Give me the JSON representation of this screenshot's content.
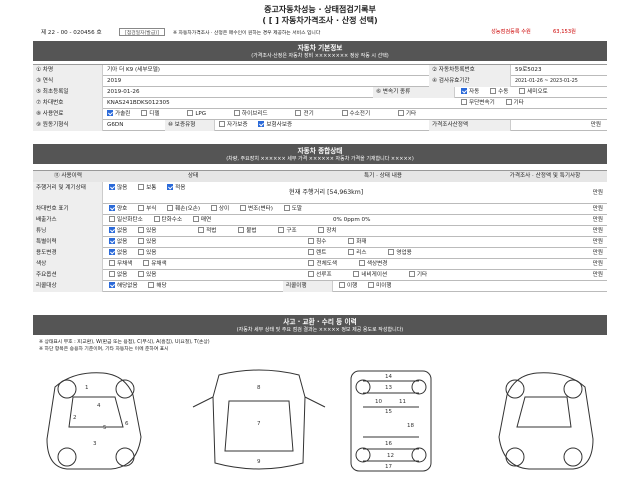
{
  "header": {
    "title": "중고자동차성능 · 상태점검기록부",
    "subtitle": "( [ ] 자동차가격조사 · 산정 선택)",
    "doc_no": "제 22 - 00 - 020456 호",
    "doc_no_box": "[점검일자(발급)]",
    "notice": "※ 자동차가격조사 · 산정은 매수인이 원하는 경우 제공하는 서비스 입니다",
    "right_red": "성능점검등록 수원",
    "fee": "63,153원"
  },
  "sections": {
    "basic": {
      "title": "자동차 기본정보",
      "sub": "(가격조사·산정은 자동차 장비 ×××××××× 정상 작동 시 선택)"
    },
    "state": {
      "title": "자동차 종합상태",
      "sub": "(차량, 주요장치 ×××××× 세부 가격 ×××××× 자동차 가격을 기재합니다 ×××××)"
    },
    "repair": {
      "title": "사고 · 교환 · 수리 등 이력",
      "sub": "(자동차 세부 상태 및 주요 점검 결과는 ××××× 정보 제공 용도로 작성합니다)"
    }
  },
  "basic_rows": [
    {
      "n": "① 차명",
      "v": "기아 더 K9 (세부모델)",
      "n2": "② 자동차등록번호",
      "v2": "59로5023"
    },
    {
      "n": "③ 연식",
      "v": "2019",
      "n2": "④ 검사유효기간",
      "v2": "2021-01-26 ~ 2023-01-25"
    },
    {
      "n": "⑤ 최초등록일",
      "v": "2019-01-26",
      "n2": "⑥ 변속기 종류",
      "v2": ""
    },
    {
      "n": "⑦ 차대번호",
      "v": "KNAS241BDKS012305",
      "n2": "",
      "v2": ""
    },
    {
      "n": "⑧ 사용연료",
      "v": "",
      "n2": "",
      "v2": ""
    },
    {
      "n": "⑨ 원동기형식",
      "v": "G6DN",
      "n2": "⑩ 보증유형",
      "v2": "보험사보증"
    }
  ],
  "transmission": [
    "자동",
    "수동",
    "세미오토",
    "무단변속기",
    "기타"
  ],
  "fuel": [
    "가솔린",
    "디젤",
    "LPG",
    "하이브리드",
    "전기",
    "수소전기",
    "기타"
  ],
  "warranty": [
    "자가보증",
    "보험사보증"
  ],
  "warranty_price": "가격조사산정액",
  "won": "만원",
  "state_header": {
    "c1": "⑪ 사용이력",
    "c2": "상태",
    "c3": "특기 · 상태 내용",
    "c4": "가격조사 · 산정액 및 특기사항"
  },
  "state_rows": [
    {
      "n": "주행거리 및 계기상태",
      "opts": [
        "많음",
        "보통",
        "적음"
      ],
      "d": "현재 주행거리 [54,963km]",
      "p": "만원"
    },
    {
      "n": "차대번호 표기",
      "opts": [
        "양호",
        "부식",
        "훼손(오손)",
        "상이",
        "변조(변타)",
        "도말"
      ],
      "d": "",
      "p": "만원"
    },
    {
      "n": "배출가스",
      "opts": [
        "일산화탄소",
        "탄화수소",
        "매연"
      ],
      "d": "0%  0ppm  0%",
      "p": "만원"
    },
    {
      "n": "튜닝",
      "opts": [
        "없음",
        "있음",
        "적법",
        "불법",
        "구조",
        "장치"
      ],
      "d": "",
      "p": "만원"
    },
    {
      "n": "특별이력",
      "opts": [
        "없음",
        "있음",
        "침수",
        "화재"
      ],
      "d": "",
      "p": "만원"
    },
    {
      "n": "용도변경",
      "opts": [
        "없음",
        "있음",
        "렌트",
        "리스",
        "영업용"
      ],
      "d": "",
      "p": "만원"
    },
    {
      "n": "색상",
      "opts": [
        "무채색",
        "유채색",
        "전체도색",
        "색상변경"
      ],
      "d": "",
      "p": "만원"
    },
    {
      "n": "주요옵션",
      "opts": [
        "없음",
        "있음",
        "선루프",
        "네비게이션",
        "기타"
      ],
      "d": "",
      "p": "만원"
    },
    {
      "n": "리콜대상",
      "opts": [
        "해당없음",
        "해당"
      ],
      "d": "리콜이행",
      "p": ""
    }
  ],
  "recall_done": [
    "이행",
    "미이행"
  ],
  "legend": [
    "※ 상태표시 부호 : X(교환), W(판금 또는 용접), C(부식), A(흠집), U(요철), T(손상)",
    "※ 하단 항목은 승용차 기준이며, 기타 자동차는 이에 준하여 표시"
  ],
  "car_parts": [
    "1",
    "2",
    "3",
    "4",
    "5",
    "6",
    "7",
    "8",
    "9",
    "10",
    "11",
    "12",
    "13",
    "14",
    "15",
    "16",
    "17",
    "18"
  ]
}
